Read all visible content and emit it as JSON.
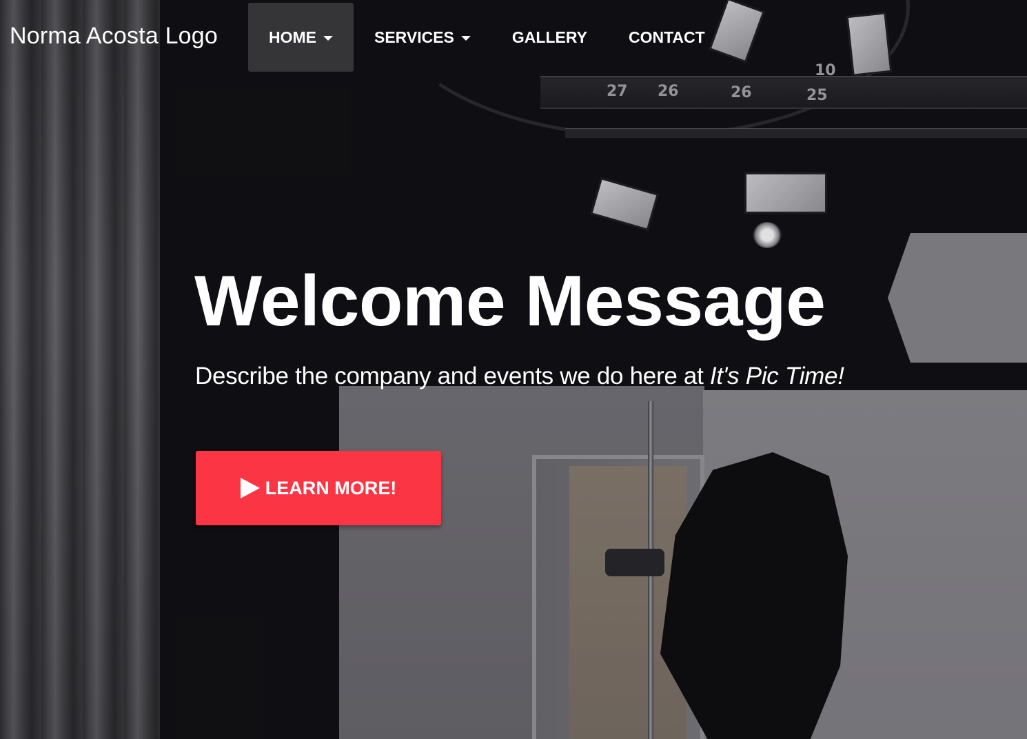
{
  "brand": {
    "logo_text": "Norma Acosta Logo"
  },
  "nav": {
    "items": [
      {
        "label": "HOME",
        "active": true,
        "dropdown": true
      },
      {
        "label": "SERVICES",
        "active": false,
        "dropdown": true
      },
      {
        "label": "GALLERY",
        "active": false,
        "dropdown": false
      },
      {
        "label": "CONTACT",
        "active": false,
        "dropdown": false
      }
    ]
  },
  "hero": {
    "title": "Welcome Message",
    "subtitle_prefix": "Describe the company and events we do here at ",
    "subtitle_emphasis": "It's Pic Time!",
    "cta_label": "LEARN MORE!",
    "cta_icon": "play-icon"
  },
  "background": {
    "rig_numbers": [
      "27",
      "26",
      "26",
      "25",
      "10"
    ]
  },
  "colors": {
    "accent": "#fc3545",
    "nav_active_bg": "#3c3c3e",
    "text": "#ffffff"
  }
}
